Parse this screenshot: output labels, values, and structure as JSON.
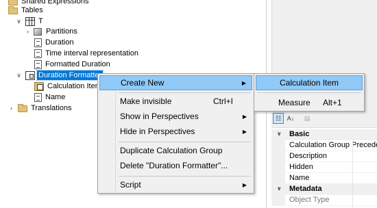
{
  "tree": {
    "shared_expressions": "Shared Expressions",
    "tables": "Tables",
    "table_t": "T",
    "partitions": "Partitions",
    "duration": "Duration",
    "time_interval": "Time interval representation",
    "formatted_duration": "Formatted Duration",
    "duration_formatter": "Duration Formatter",
    "calculation_item": "Calculation Item",
    "name": "Name",
    "translations": "Translations"
  },
  "context_menu": {
    "create_new": "Create New",
    "make_invisible": "Make invisible",
    "make_invisible_shortcut": "Ctrl+I",
    "show_in_perspectives": "Show in Perspectives",
    "hide_in_perspectives": "Hide in Perspectives",
    "duplicate": "Duplicate Calculation Group",
    "delete": "Delete \"Duration Formatter\"...",
    "script": "Script"
  },
  "submenu": {
    "calculation_item": "Calculation Item",
    "measure": "Measure",
    "measure_shortcut": "Alt+1"
  },
  "properties": {
    "cat_basic": "Basic",
    "calc_group_precedence": "Calculation Group Precede",
    "description": "Description",
    "hidden": "Hidden",
    "name": "Name",
    "cat_metadata": "Metadata",
    "object_type": "Object Type"
  },
  "colors": {
    "selection": "#0078d7",
    "menu_highlight": "#91c9f7",
    "menu_bg": "#f0f0f0"
  }
}
